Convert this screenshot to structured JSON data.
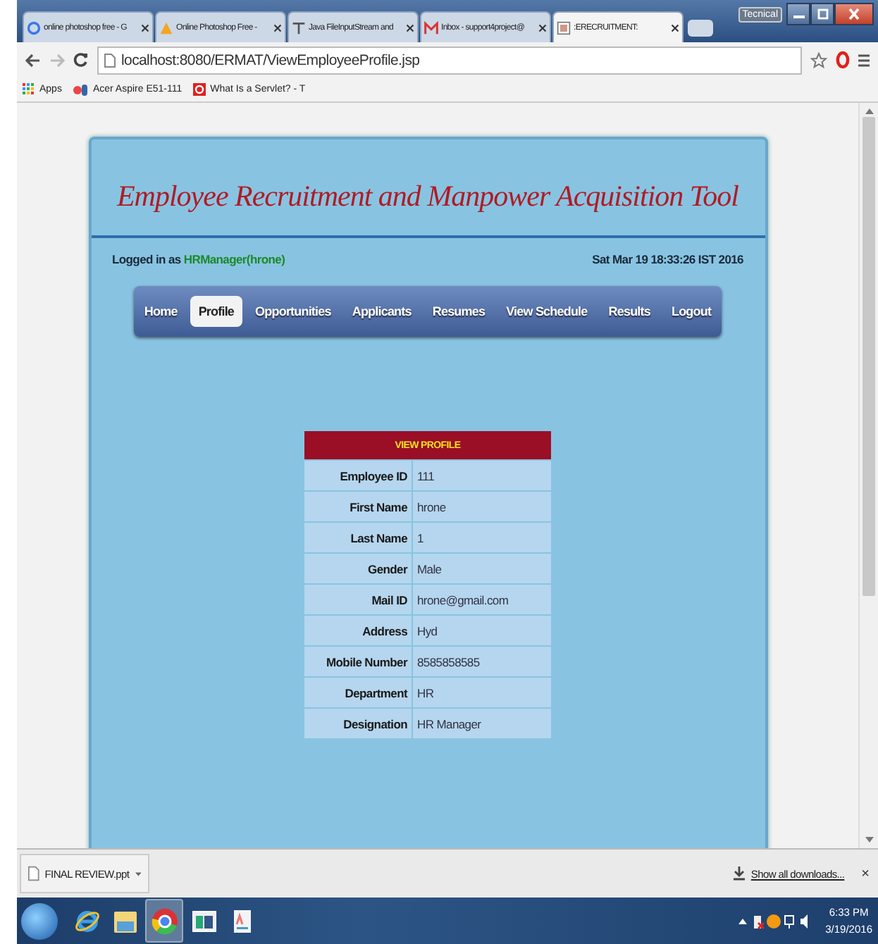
{
  "browser": {
    "tabs": [
      {
        "title": "online photoshop free - G",
        "kind": "google",
        "selected": false
      },
      {
        "title": "Online Photoshop Free - ",
        "kind": "photoshop",
        "selected": false
      },
      {
        "title": "Java FileInputStream and",
        "kind": "text",
        "selected": false
      },
      {
        "title": "Inbox - support4project@",
        "kind": "gmail",
        "selected": false
      },
      {
        "title": ":ERECRUITMENT:",
        "kind": "doc",
        "selected": true
      }
    ],
    "profile_name": "Tecnical",
    "address": "localhost:8080/ERMAT/ViewEmployeeProfile.jsp",
    "bookmarks": [
      {
        "label": "Apps",
        "kind": "apps"
      },
      {
        "label": "Acer Aspire E51-111",
        "kind": "sd"
      },
      {
        "label": "What Is a Servlet? - T",
        "kind": "red"
      }
    ]
  },
  "page": {
    "title": "Employee Recruitment and Manpower Acquisition Tool",
    "logged_in_label": "Logged in as",
    "user": "HRManager(hrone)",
    "datetime": "Sat Mar 19 18:33:26 IST 2016",
    "nav": [
      {
        "label": "Home",
        "selected": false
      },
      {
        "label": "Profile",
        "selected": true
      },
      {
        "label": "Opportunities",
        "selected": false
      },
      {
        "label": "Applicants",
        "selected": false
      },
      {
        "label": "Resumes",
        "selected": false
      },
      {
        "label": "View Schedule",
        "selected": false
      },
      {
        "label": "Results",
        "selected": false
      },
      {
        "label": "Logout",
        "selected": false
      }
    ],
    "profile": {
      "heading": "VIEW PROFILE",
      "rows": [
        {
          "label": "Employee ID",
          "value": "111"
        },
        {
          "label": "First Name",
          "value": "hrone"
        },
        {
          "label": "Last Name",
          "value": "1"
        },
        {
          "label": "Gender",
          "value": "Male"
        },
        {
          "label": "Mail ID",
          "value": "hrone@gmail.com"
        },
        {
          "label": "Address",
          "value": "Hyd"
        },
        {
          "label": "Mobile Number",
          "value": "8585858585"
        },
        {
          "label": "Department",
          "value": "HR"
        },
        {
          "label": "Designation",
          "value": "HR Manager"
        }
      ]
    }
  },
  "downloads": {
    "file": "FINAL REVIEW.ppt",
    "show_all": "Show all downloads...",
    "close": "×"
  },
  "taskbar": {
    "apps": [
      {
        "kind": "ie",
        "selected": false
      },
      {
        "kind": "folder",
        "selected": false
      },
      {
        "kind": "chrome",
        "selected": true
      },
      {
        "kind": "window",
        "selected": false
      },
      {
        "kind": "doc",
        "selected": false
      }
    ],
    "time": "6:33 PM",
    "date": "3/19/2016"
  }
}
